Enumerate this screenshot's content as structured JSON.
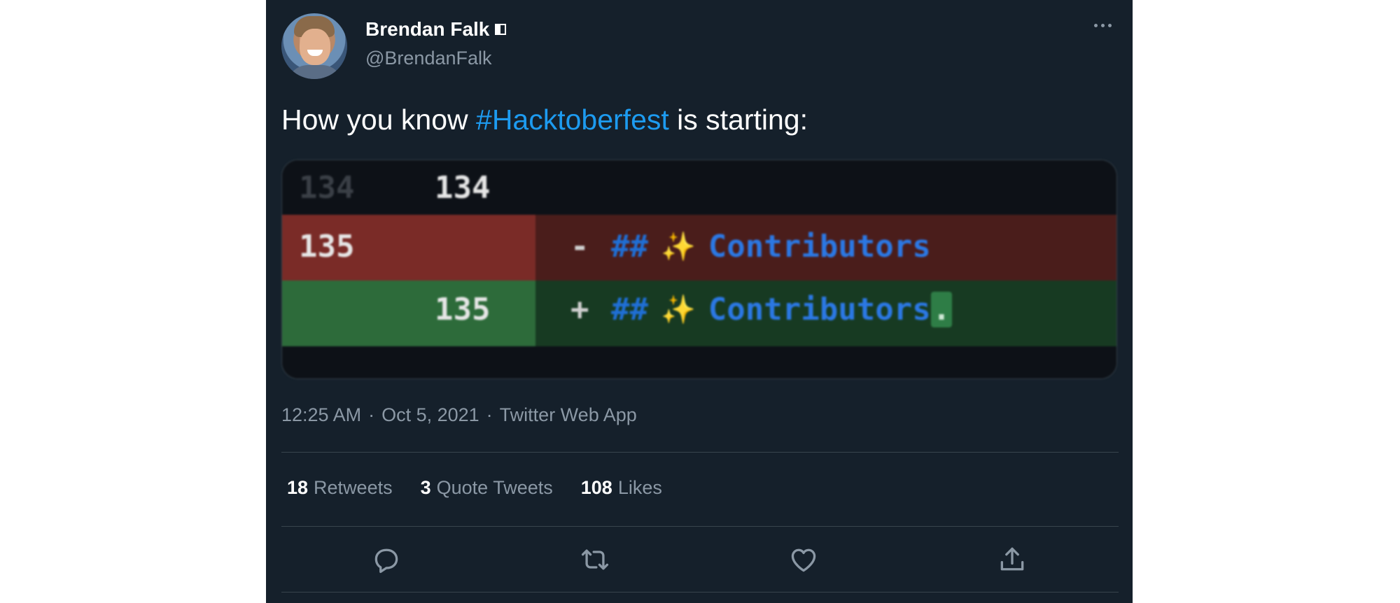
{
  "author": {
    "name": "Brendan Falk",
    "handle": "@BrendanFalk"
  },
  "tweet": {
    "text_before": "How you know ",
    "hashtag": "#Hacktoberfest",
    "text_after": " is starting:"
  },
  "media": {
    "context_row": {
      "old_num": "134",
      "new_num": "134"
    },
    "deleted_row": {
      "old_num": "135",
      "sign": "-",
      "hashes": "##",
      "sparkle": "✨",
      "text": "Contributors"
    },
    "added_row": {
      "new_num": "135",
      "sign": "+",
      "hashes": "##",
      "sparkle": "✨",
      "text": "Contributors",
      "added_char": "."
    }
  },
  "meta": {
    "time": "12:25 AM",
    "sep1": "·",
    "date": "Oct 5, 2021",
    "sep2": "·",
    "source": "Twitter Web App"
  },
  "stats": {
    "retweets_count": "18",
    "retweets_label": "Retweets",
    "quotes_count": "3",
    "quotes_label": "Quote Tweets",
    "likes_count": "108",
    "likes_label": "Likes"
  },
  "colors": {
    "background": "#15202b",
    "link": "#1d9bf0",
    "muted": "#8b98a5",
    "diff_deleted": "#4a1d1b",
    "diff_added": "#173a22"
  },
  "icons": [
    "more-icon",
    "reply-icon",
    "retweet-icon",
    "like-icon",
    "share-icon",
    "verified-icon"
  ]
}
